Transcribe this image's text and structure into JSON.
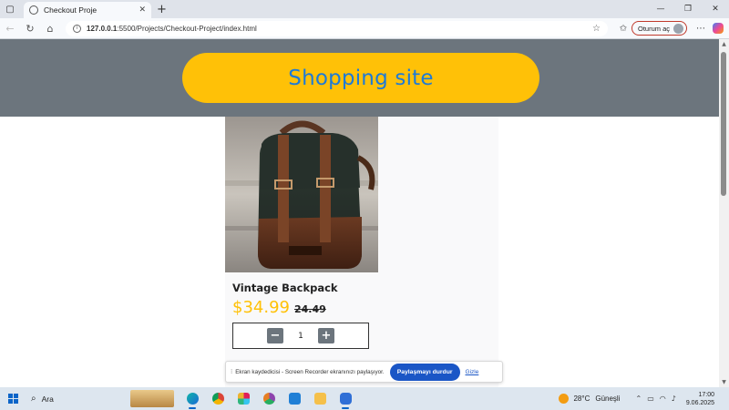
{
  "browser": {
    "tab_title": "Checkout Proje",
    "url_host": "127.0.0.1",
    "url_rest": ":5500/Projects/Checkout-Project/index.html",
    "signin_label": "Oturum aç"
  },
  "site": {
    "title": "Shopping site",
    "header_bg": "#6c757d",
    "title_pill_color": "#ffc107",
    "title_text_color": "#1e7ad6"
  },
  "product": {
    "name": "Vintage Backpack",
    "price": "$34.99",
    "old_price": "24.49",
    "quantity": "1",
    "decrement_label": "−",
    "increment_label": "+"
  },
  "share_notification": {
    "text": "Ekran kaydedicisi - Screen Recorder ekranınızı paylaşıyor.",
    "stop_label": "Paylaşmayı durdur",
    "hide_label": "Gizle"
  },
  "taskbar": {
    "search_label": "Ara",
    "temperature": "28°C",
    "weather_condition": "Güneşli",
    "time": "17:00",
    "date": "9.06.2025"
  }
}
